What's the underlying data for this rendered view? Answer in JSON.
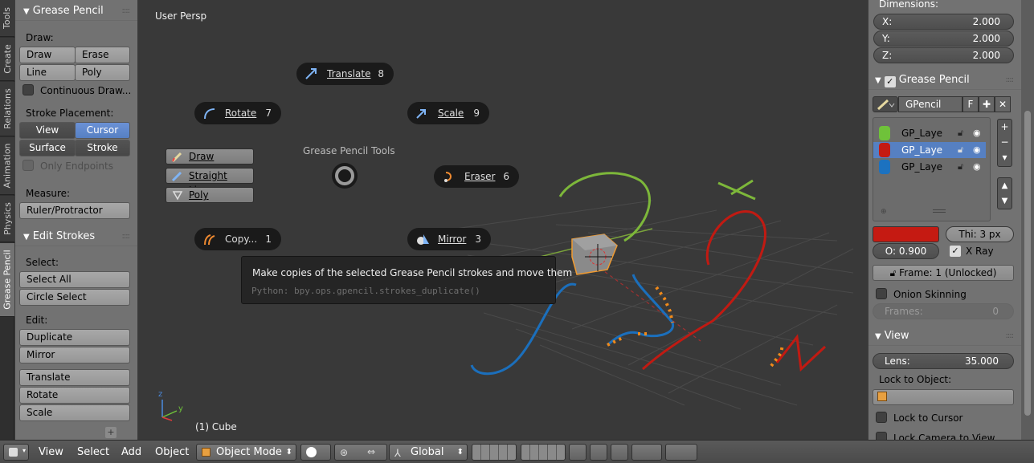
{
  "tabs": [
    "Tools",
    "Create",
    "Relations",
    "Animation",
    "Physics",
    "Grease Pencil"
  ],
  "tool": {
    "gp_title": "Grease Pencil",
    "draw_label": "Draw:",
    "draw": "Draw",
    "erase": "Erase",
    "line": "Line",
    "poly": "Poly",
    "continuous": "Continuous Draw...",
    "placement_label": "Stroke Placement:",
    "view": "View",
    "cursor": "Cursor",
    "surface": "Surface",
    "stroke": "Stroke",
    "only_endpoints": "Only Endpoints",
    "measure_label": "Measure:",
    "ruler": "Ruler/Protractor",
    "edit_title": "Edit Strokes",
    "select_label": "Select:",
    "select_all": "Select All",
    "circle_select": "Circle Select",
    "edit_label": "Edit:",
    "duplicate": "Duplicate",
    "mirror": "Mirror",
    "translate": "Translate",
    "rotate": "Rotate",
    "scale": "Scale",
    "plus": "+"
  },
  "viewport": {
    "persp": "User Persp",
    "object": "(1) Cube",
    "pie_title": "Grease Pencil Tools",
    "pie": {
      "translate": "Translate",
      "translate_key": "8",
      "rotate": "Rotate",
      "rotate_key": "7",
      "scale": "Scale",
      "scale_key": "9",
      "eraser": "Eraser",
      "eraser_key": "6",
      "copy": "Copy...",
      "copy_key": "1",
      "mirror": "Mirror",
      "mirror_key": "3"
    },
    "pie_left": {
      "draw": "Draw",
      "straight": "Straight Lines",
      "poly": "Poly"
    },
    "tooltip": {
      "title": "Make copies of the selected Grease Pencil strokes and move them",
      "python": "Python: bpy.ops.gpencil.strokes_duplicate()"
    },
    "axis": {
      "z": "z",
      "y": "y"
    }
  },
  "props": {
    "dimensions": "Dimensions:",
    "x_label": "X:",
    "x": "2.000",
    "y_label": "Y:",
    "y": "2.000",
    "z_label": "Z:",
    "z": "2.000",
    "gp_title": "Grease Pencil",
    "gp_name": "GPencil",
    "f": "F",
    "layers": [
      {
        "name": "GP_Laye",
        "color": "#6fc23a"
      },
      {
        "name": "GP_Laye",
        "color": "#c51a12"
      },
      {
        "name": "GP_Laye",
        "color": "#1c72c0"
      }
    ],
    "thick": "Thi: 3 px",
    "opacity": "O: 0.900",
    "xray": "X Ray",
    "frame": "Frame: 1 (Unlocked)",
    "onion": "Onion Skinning",
    "frames_label": "Frames:",
    "frames": "0",
    "view_title": "View",
    "lens_label": "Lens:",
    "lens": "35.000",
    "lock_obj": "Lock to Object:",
    "lock_cursor": "Lock to Cursor",
    "lock_camera": "Lock Camera to View"
  },
  "header": {
    "view": "View",
    "select": "Select",
    "add": "Add",
    "object": "Object",
    "mode": "Object Mode",
    "orient": "Global"
  },
  "colors": {
    "accent": "#5680c2",
    "layer_active": "#5680c2",
    "stroke_green": "#7db73a",
    "stroke_red": "#c11a12",
    "stroke_blue": "#1b6fbc",
    "stroke_orange": "#f08a1a"
  }
}
